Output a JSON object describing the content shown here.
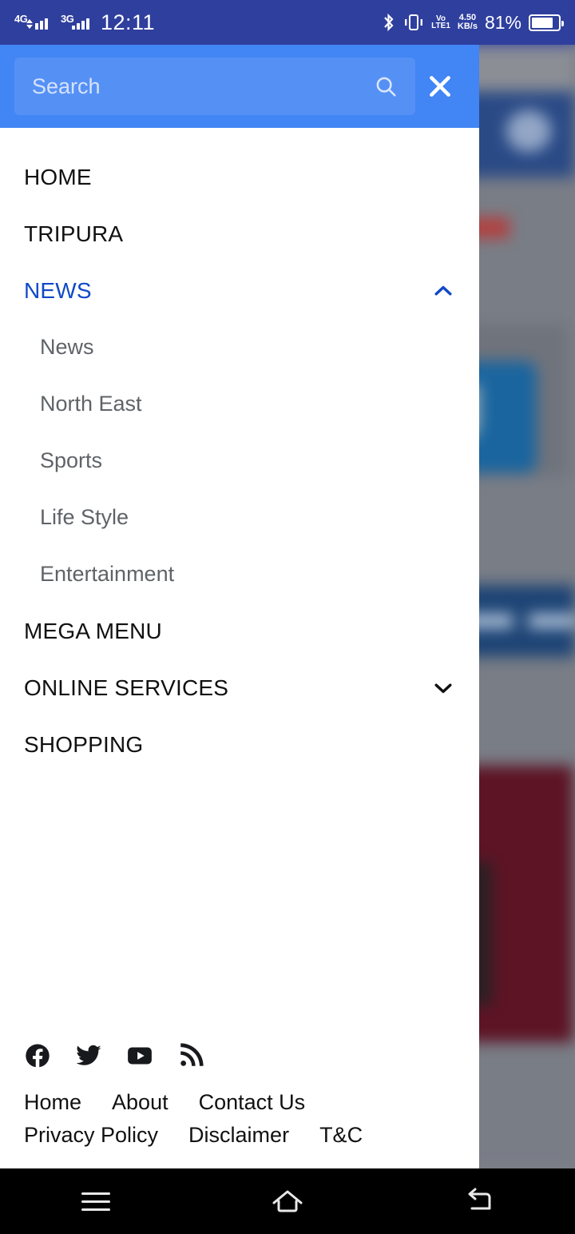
{
  "status_bar": {
    "network_1": "4G",
    "network_2": "3G",
    "time": "12:11",
    "volte_top": "Vo",
    "volte_bottom": "LTE1",
    "net_speed_value": "4.50",
    "net_speed_unit": "KB/s",
    "battery_percent": "81%",
    "bluetooth_icon": "bluetooth-icon",
    "vibrate_icon": "vibrate-icon",
    "battery_icon": "battery-icon",
    "battery_level": 81
  },
  "search": {
    "value": "",
    "placeholder": "Search",
    "search_icon": "search-icon",
    "close_icon": "close-icon"
  },
  "menu": {
    "items": [
      {
        "label": "HOME",
        "active": false,
        "chevron": ""
      },
      {
        "label": "TRIPURA",
        "active": false,
        "chevron": ""
      },
      {
        "label": "NEWS",
        "active": true,
        "chevron": "up"
      },
      {
        "label": "MEGA MENU",
        "active": false,
        "chevron": ""
      },
      {
        "label": "ONLINE SERVICES",
        "active": false,
        "chevron": "down"
      },
      {
        "label": "SHOPPING",
        "active": false,
        "chevron": ""
      }
    ],
    "news_submenu": [
      {
        "label": "News"
      },
      {
        "label": "North East"
      },
      {
        "label": "Sports"
      },
      {
        "label": "Life Style"
      },
      {
        "label": "Entertainment"
      }
    ]
  },
  "footer": {
    "socials": [
      {
        "name": "facebook-icon"
      },
      {
        "name": "twitter-icon"
      },
      {
        "name": "youtube-icon"
      },
      {
        "name": "rss-icon"
      }
    ],
    "links_row1": [
      "Home",
      "About",
      "Contact Us"
    ],
    "links_row2": [
      "Privacy Policy",
      "Disclaimer",
      "T&C"
    ]
  },
  "navigation_bar": {
    "recents": "recents-icon",
    "home": "home-icon",
    "back": "back-icon"
  },
  "colors": {
    "status_bar": "#2f3f9e",
    "search_header": "#4285f4",
    "accent_blue": "#1148c7",
    "submenu_text": "#5f6368",
    "drawer_bg": "#ffffff",
    "nav_bar": "#000000"
  }
}
